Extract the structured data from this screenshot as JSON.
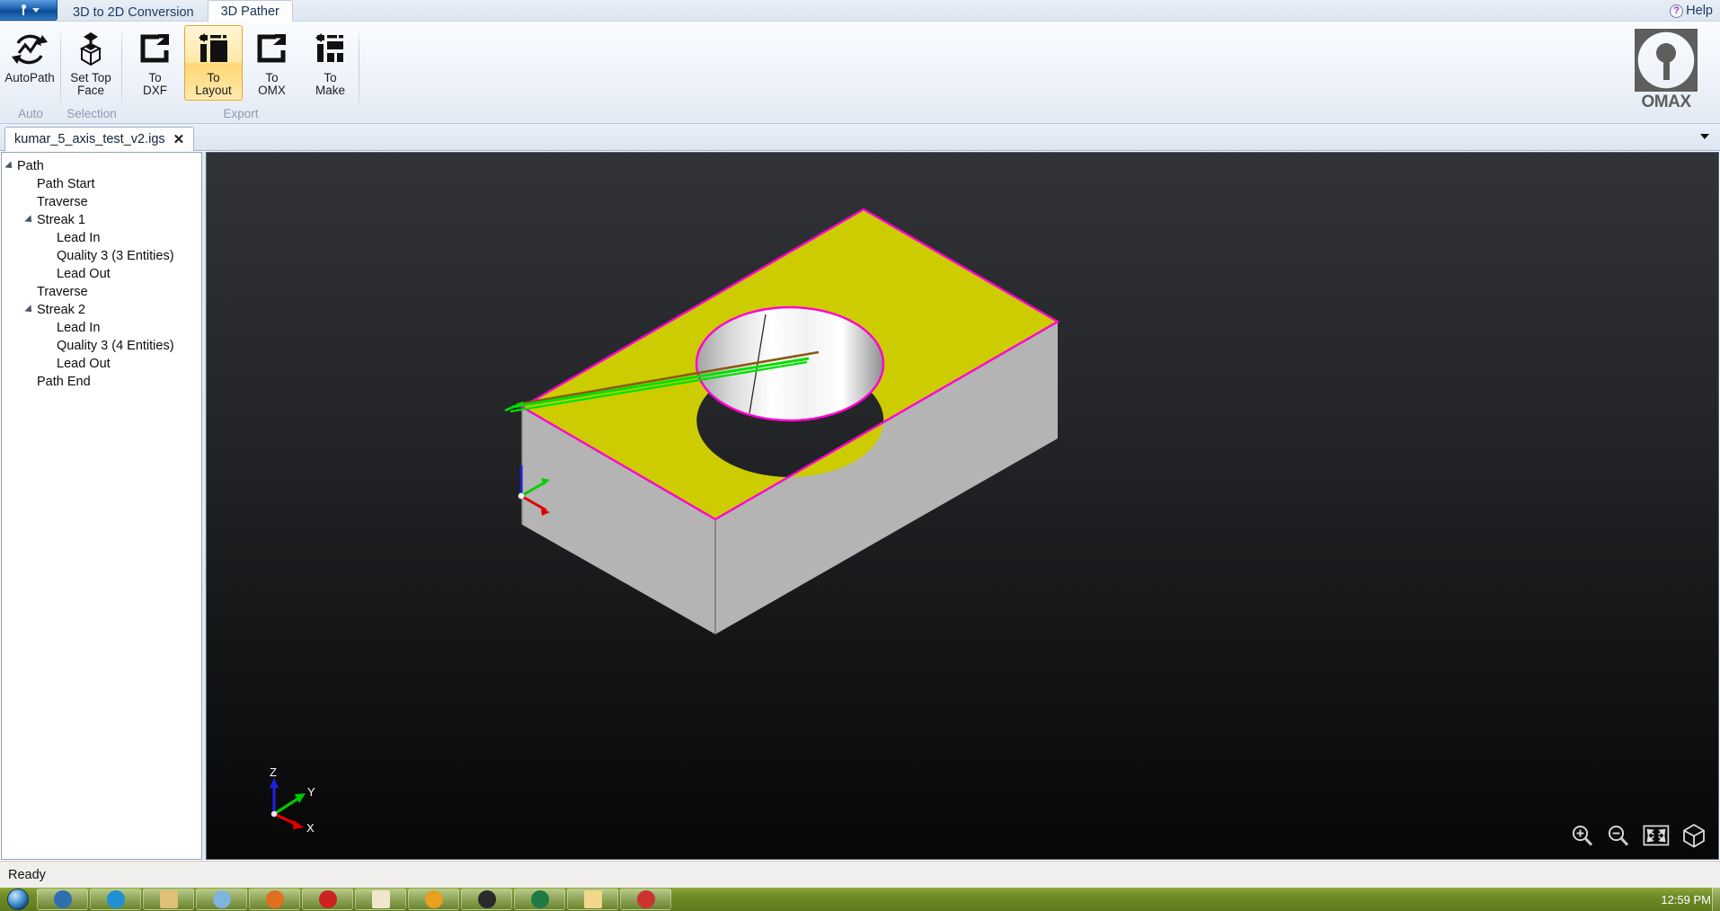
{
  "app": {
    "app_button_icon": "omax-nozzle-icon",
    "ribbon_tabs": [
      {
        "label": "3D to 2D Conversion",
        "active": false
      },
      {
        "label": "3D Pather",
        "active": true
      }
    ],
    "help_label": "Help",
    "help_icon": "question-mark-icon",
    "logo_text": "OMAX"
  },
  "ribbon": {
    "groups": [
      {
        "label": "Auto",
        "buttons": [
          {
            "label_line1": "AutoPath",
            "label_line2": "",
            "icon": "autopath-icon",
            "selected": false
          }
        ]
      },
      {
        "label": "Selection",
        "buttons": [
          {
            "label_line1": "Set Top",
            "label_line2": "Face",
            "icon": "set-top-face-icon",
            "selected": false
          }
        ]
      },
      {
        "label": "Export",
        "buttons": [
          {
            "label_line1": "To",
            "label_line2": "DXF",
            "icon": "export-dxf-icon",
            "selected": false
          },
          {
            "label_line1": "To",
            "label_line2": "Layout",
            "icon": "export-layout-icon",
            "selected": true
          },
          {
            "label_line1": "To",
            "label_line2": "OMX",
            "icon": "export-omx-icon",
            "selected": false
          },
          {
            "label_line1": "To",
            "label_line2": "Make",
            "icon": "export-make-icon",
            "selected": false
          }
        ]
      }
    ]
  },
  "document_tabs": {
    "tabs": [
      {
        "label": "kumar_5_axis_test_v2.igs",
        "close_icon": "close-icon"
      }
    ],
    "overflow_icon": "chevron-down-icon"
  },
  "tree": {
    "nodes": [
      {
        "label": "Path",
        "indent": 0,
        "expander": true
      },
      {
        "label": "Path Start",
        "indent": 1,
        "expander": false
      },
      {
        "label": "Traverse",
        "indent": 1,
        "expander": false
      },
      {
        "label": "Streak 1",
        "indent": 1,
        "expander": true
      },
      {
        "label": "Lead In",
        "indent": 2,
        "expander": false
      },
      {
        "label": "Quality 3 (3 Entities)",
        "indent": 2,
        "expander": false
      },
      {
        "label": "Lead Out",
        "indent": 2,
        "expander": false
      },
      {
        "label": "Traverse",
        "indent": 1,
        "expander": false
      },
      {
        "label": "Streak 2",
        "indent": 1,
        "expander": true
      },
      {
        "label": "Lead In",
        "indent": 2,
        "expander": false
      },
      {
        "label": "Quality 3 (4 Entities)",
        "indent": 2,
        "expander": false
      },
      {
        "label": "Lead Out",
        "indent": 2,
        "expander": false
      },
      {
        "label": "Path End",
        "indent": 1,
        "expander": false
      }
    ]
  },
  "viewport": {
    "model": {
      "description": "rectangular block with tapered circular through-hole",
      "top_face_color": "#cccc00",
      "edge_highlight_color": "#ff00d0",
      "side_face_color": "#b4b4b4",
      "bore_color_light": "#ffffff",
      "bore_color_dark": "#8e8e8e",
      "toolpath_color": "#00e000",
      "lead_color": "#8a5a12"
    },
    "axis_triad": {
      "x_label": "X",
      "x_color": "#e00000",
      "y_label": "Y",
      "y_color": "#00d000",
      "z_label": "Z",
      "z_color": "#2020e0"
    },
    "tools": [
      {
        "icon": "zoom-in-icon"
      },
      {
        "icon": "zoom-out-icon"
      },
      {
        "icon": "fit-to-window-icon"
      },
      {
        "icon": "iso-view-cube-icon"
      }
    ]
  },
  "status": {
    "text": "Ready"
  },
  "taskbar": {
    "start_icon": "windows-orb-icon",
    "items": [
      {
        "icon": "media-player-icon",
        "color": "#2f6fb0"
      },
      {
        "icon": "internet-explorer-icon",
        "color": "#1f8fd6"
      },
      {
        "icon": "explorer-folder-icon",
        "color": "#e0c074"
      },
      {
        "icon": "window-app-icon",
        "color": "#7fb4dd"
      },
      {
        "icon": "firefox-icon",
        "color": "#e07020"
      },
      {
        "icon": "red-app-icon",
        "color": "#cc2222"
      },
      {
        "icon": "document-app-icon",
        "color": "#f0e6cc"
      },
      {
        "icon": "outlook-icon",
        "color": "#e8a020"
      },
      {
        "icon": "terminal-icon",
        "color": "#2a2a2a"
      },
      {
        "icon": "excel-icon",
        "color": "#1f7a44"
      },
      {
        "icon": "folder-window-icon",
        "color": "#f2d78a"
      },
      {
        "icon": "cd-app-icon",
        "color": "#cc3333"
      }
    ],
    "clock": "12:59 PM"
  }
}
